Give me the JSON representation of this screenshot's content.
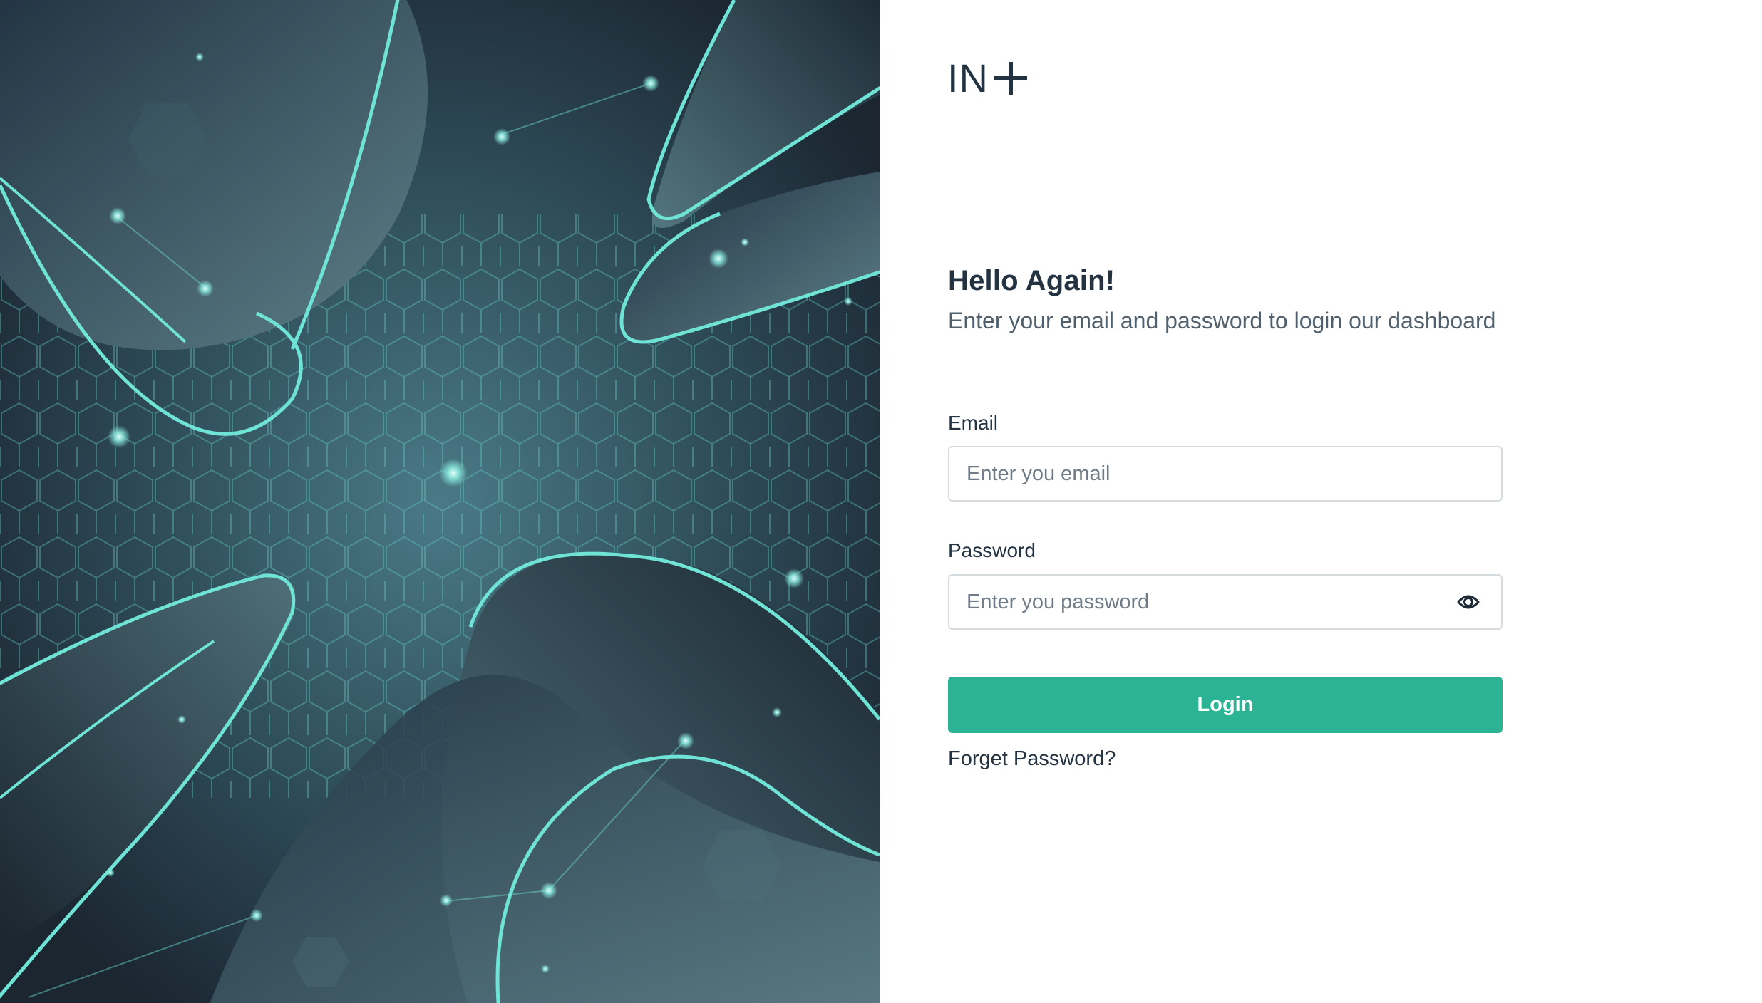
{
  "brand": {
    "logo_text": "IN",
    "logo_mark": "plus-icon"
  },
  "login": {
    "heading": "Hello Again!",
    "subheading": "Enter your email and password to login our dashboard",
    "email_label": "Email",
    "email_placeholder": "Enter you email",
    "password_label": "Password",
    "password_placeholder": "Enter you password",
    "password_toggle_icon": "eye-icon",
    "submit_label": "Login",
    "forgot_label": "Forget Password?"
  },
  "colors": {
    "primary": "#2bb394",
    "text_dark": "#243341",
    "text_muted": "#51606d",
    "border": "#d6dbe0",
    "hero_bg": "#1c2833",
    "hero_accent": "#6fe3d5"
  }
}
